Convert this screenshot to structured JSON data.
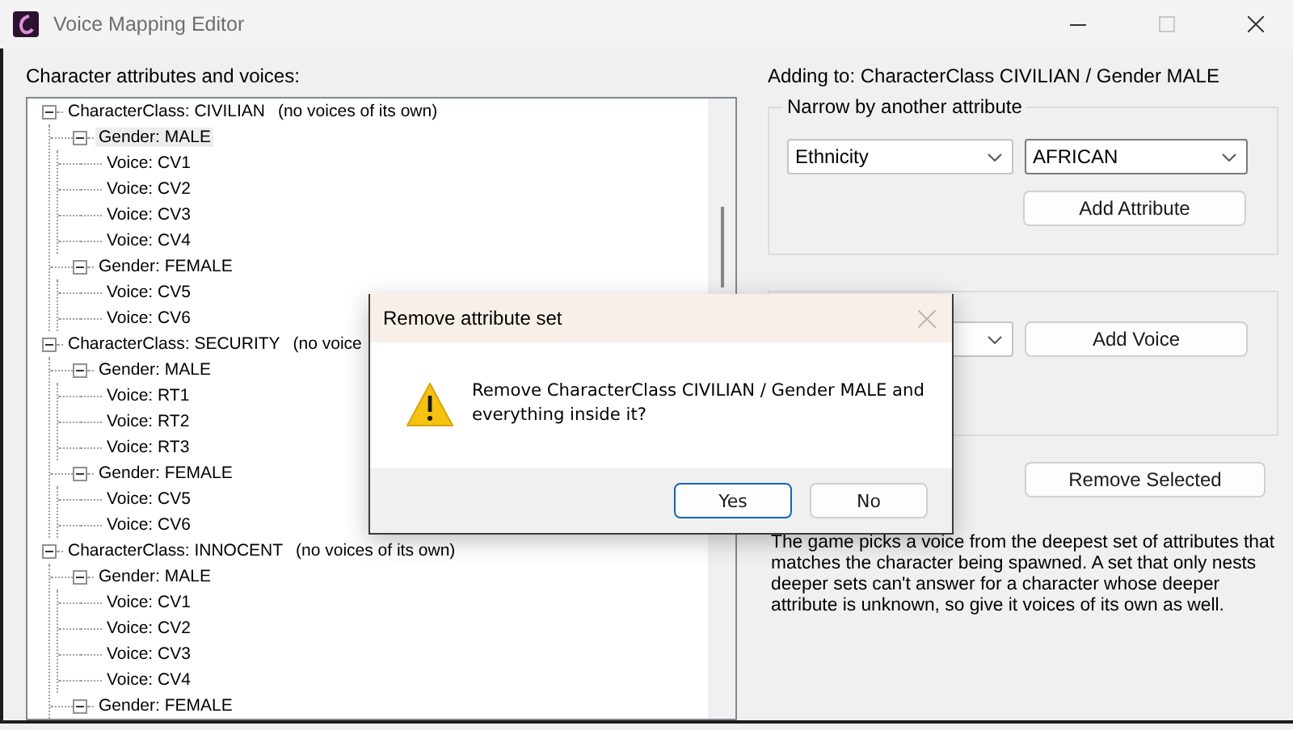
{
  "window": {
    "title": "Voice Mapping Editor"
  },
  "tree": {
    "label": "Character attributes and voices:",
    "nodes": [
      {
        "label": "CharacterClass: CIVILIAN",
        "note": "(no voices of its own)",
        "expanded": true,
        "selected": false,
        "children": [
          {
            "label": "Gender: MALE",
            "expanded": true,
            "selected": true,
            "children": [
              {
                "label": "Voice: CV1",
                "selected": false
              },
              {
                "label": "Voice: CV2",
                "selected": false
              },
              {
                "label": "Voice: CV3",
                "selected": false
              },
              {
                "label": "Voice: CV4",
                "selected": false
              }
            ]
          },
          {
            "label": "Gender: FEMALE",
            "expanded": true,
            "selected": false,
            "children": [
              {
                "label": "Voice: CV5",
                "selected": false
              },
              {
                "label": "Voice: CV6",
                "selected": false
              }
            ]
          }
        ]
      },
      {
        "label": "CharacterClass: SECURITY",
        "note": "(no voice",
        "expanded": true,
        "selected": false,
        "children": [
          {
            "label": "Gender: MALE",
            "expanded": true,
            "selected": false,
            "children": [
              {
                "label": "Voice: RT1",
                "selected": false
              },
              {
                "label": "Voice: RT2",
                "selected": false
              },
              {
                "label": "Voice: RT3",
                "selected": false
              }
            ]
          },
          {
            "label": "Gender: FEMALE",
            "expanded": true,
            "selected": false,
            "children": [
              {
                "label": "Voice: CV5",
                "selected": false
              },
              {
                "label": "Voice: CV6",
                "selected": false
              }
            ]
          }
        ]
      },
      {
        "label": "CharacterClass: INNOCENT",
        "note": "(no voices of its own)",
        "expanded": true,
        "selected": false,
        "children": [
          {
            "label": "Gender: MALE",
            "expanded": true,
            "selected": false,
            "children": [
              {
                "label": "Voice: CV1",
                "selected": false
              },
              {
                "label": "Voice: CV2",
                "selected": false
              },
              {
                "label": "Voice: CV3",
                "selected": false
              },
              {
                "label": "Voice: CV4",
                "selected": false
              }
            ]
          },
          {
            "label": "Gender: FEMALE",
            "expanded": true,
            "selected": false
          }
        ]
      }
    ]
  },
  "target": "Adding to: CharacterClass CIVILIAN / Gender MALE",
  "attribute_group": {
    "title": "Narrow by another attribute",
    "attribute": "Ethnicity",
    "value": "AFRICAN",
    "button": "Add Attribute"
  },
  "voice_group": {
    "button": "Add Voice"
  },
  "remove_button": "Remove Selected",
  "help_text": "The game picks a voice from the deepest set of attributes that matches the character being spawned. A set that only nests deeper sets can't answer for a character whose deeper attribute is unknown, so give it voices of its own as well.",
  "dialog": {
    "title": "Remove attribute set",
    "message": "Remove CharacterClass CIVILIAN / Gender MALE and everything inside it?",
    "buttons": [
      {
        "label": "Yes",
        "default": true
      },
      {
        "label": "No",
        "default": false
      }
    ]
  }
}
